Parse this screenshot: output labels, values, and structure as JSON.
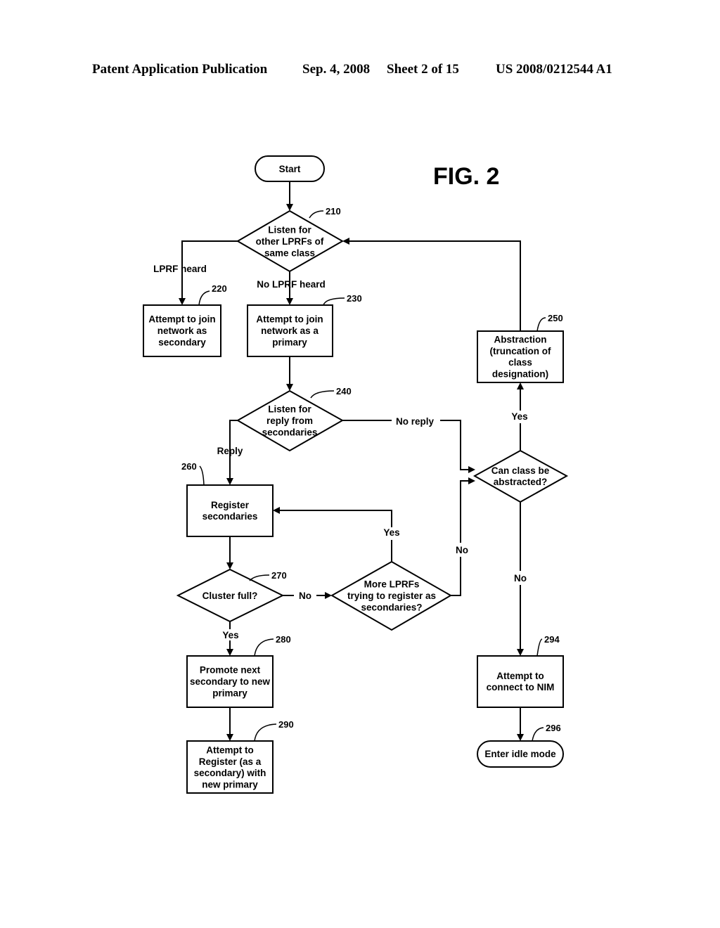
{
  "header": {
    "publication": "Patent Application Publication",
    "date": "Sep. 4, 2008",
    "sheet": "Sheet 2 of 15",
    "number": "US 2008/0212544 A1"
  },
  "figure_label": "FIG. 2",
  "nodes": {
    "start": {
      "lines": [
        "Start"
      ]
    },
    "n210": {
      "ref": "210",
      "lines": [
        "Listen for",
        "other LPRFs of",
        "same class"
      ]
    },
    "n220": {
      "ref": "220",
      "lines": [
        "Attempt to join",
        "network as",
        "secondary"
      ]
    },
    "n230": {
      "ref": "230",
      "lines": [
        "Attempt to join",
        "network as a",
        "primary"
      ]
    },
    "n240": {
      "ref": "240",
      "lines": [
        "Listen for",
        "reply from",
        "secondaries"
      ]
    },
    "n250": {
      "ref": "250",
      "lines": [
        "Abstraction",
        "(truncation of",
        "class",
        "designation)"
      ]
    },
    "n260": {
      "ref": "260",
      "lines": [
        "Register",
        "secondaries"
      ]
    },
    "n270": {
      "ref": "270",
      "lines": [
        "Cluster full?"
      ]
    },
    "n_more": {
      "lines": [
        "More LPRFs",
        "trying to register as",
        "secondaries?"
      ]
    },
    "n_abs": {
      "lines": [
        "Can class be",
        "abstracted?"
      ]
    },
    "n280": {
      "ref": "280",
      "lines": [
        "Promote next",
        "secondary to new",
        "primary"
      ]
    },
    "n290": {
      "ref": "290",
      "lines": [
        "Attempt to",
        "Register (as a",
        "secondary) with",
        "new primary"
      ]
    },
    "n294": {
      "ref": "294",
      "lines": [
        "Attempt to",
        "connect to NIM"
      ]
    },
    "n296": {
      "ref": "296",
      "lines": [
        "Enter idle mode"
      ]
    }
  },
  "edge_labels": {
    "lprf_heard": "LPRF heard",
    "no_lprf_heard": "No LPRF heard",
    "reply": "Reply",
    "no_reply": "No reply",
    "abs_yes": "Yes",
    "abs_no": "No",
    "more_yes": "Yes",
    "more_no": "No",
    "cluster_no": "No",
    "cluster_yes": "Yes"
  }
}
